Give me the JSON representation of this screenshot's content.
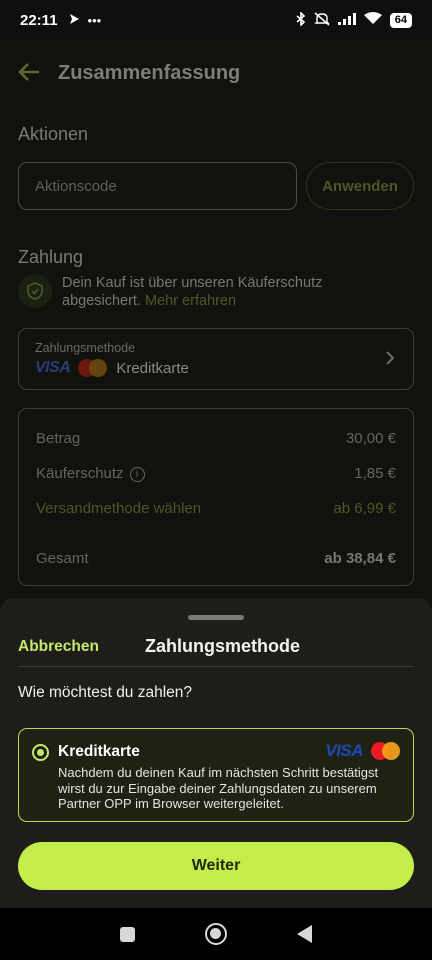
{
  "status_bar": {
    "time": "22:11",
    "battery": "64",
    "left_icons": [
      "direction-arrow-icon",
      "more-dots-icon"
    ],
    "right_icons": [
      "bluetooth-icon",
      "mute-icon",
      "signal-icon",
      "wifi-icon",
      "battery-icon"
    ]
  },
  "header": {
    "title": "Zusammenfassung",
    "back_icon": "arrow-left-icon"
  },
  "promo": {
    "section_title": "Aktionen",
    "code_placeholder": "Aktionscode",
    "apply_label": "Anwenden"
  },
  "payment": {
    "section_title": "Zahlung",
    "protection_text": "Dein Kauf ist über unseren Käuferschutz abgesichert.",
    "learn_more": "Mehr erfahren",
    "method_label": "Zahlungsmethode",
    "visa_text": "VISA",
    "method_value": "Kreditkarte"
  },
  "summary": {
    "amount_label": "Betrag",
    "amount_value": "30,00 €",
    "protection_label": "Käuferschutz",
    "protection_value": "1,85 €",
    "shipping_label": "Versandmethode wählen",
    "shipping_value": "ab 6,99 €",
    "total_label": "Gesamt",
    "total_value": "ab 38,84 €"
  },
  "sheet": {
    "cancel_label": "Abbrechen",
    "title": "Zahlungsmethode",
    "question": "Wie möchtest du zahlen?",
    "option": {
      "title": "Kreditkarte",
      "visa_text": "VISA",
      "description": "Nachdem du deinen Kauf im nächsten Schritt bestätigst wirst du zur Eingabe deiner Zahlungsdaten zu unserem Partner OPP im Browser weitergeleitet.",
      "selected": true
    },
    "continue_label": "Weiter"
  },
  "colors": {
    "accent": "#c4ec4a",
    "sheet_background": "#1e1d19",
    "page_background": "#11110e"
  }
}
